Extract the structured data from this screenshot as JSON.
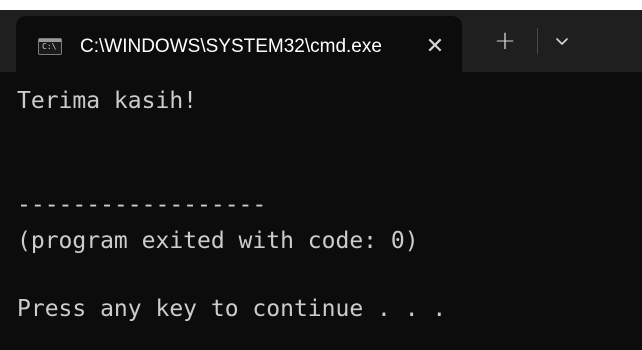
{
  "window": {
    "title": "C:\\WINDOWS\\SYSTEM32\\cmd.exe",
    "icon": "console-icon",
    "close_icon": "close-icon",
    "new_tab_icon": "plus-icon",
    "dropdown_icon": "chevron-down-icon"
  },
  "console": {
    "lines": [
      "Terima kasih!",
      "",
      "------------------",
      "(program exited with code: 0)",
      "",
      "Press any key to continue . . ."
    ]
  },
  "colors": {
    "terminal_bg": "#0c0c0c",
    "titlebar_bg": "#1f1f1f",
    "text": "#cccccc"
  }
}
